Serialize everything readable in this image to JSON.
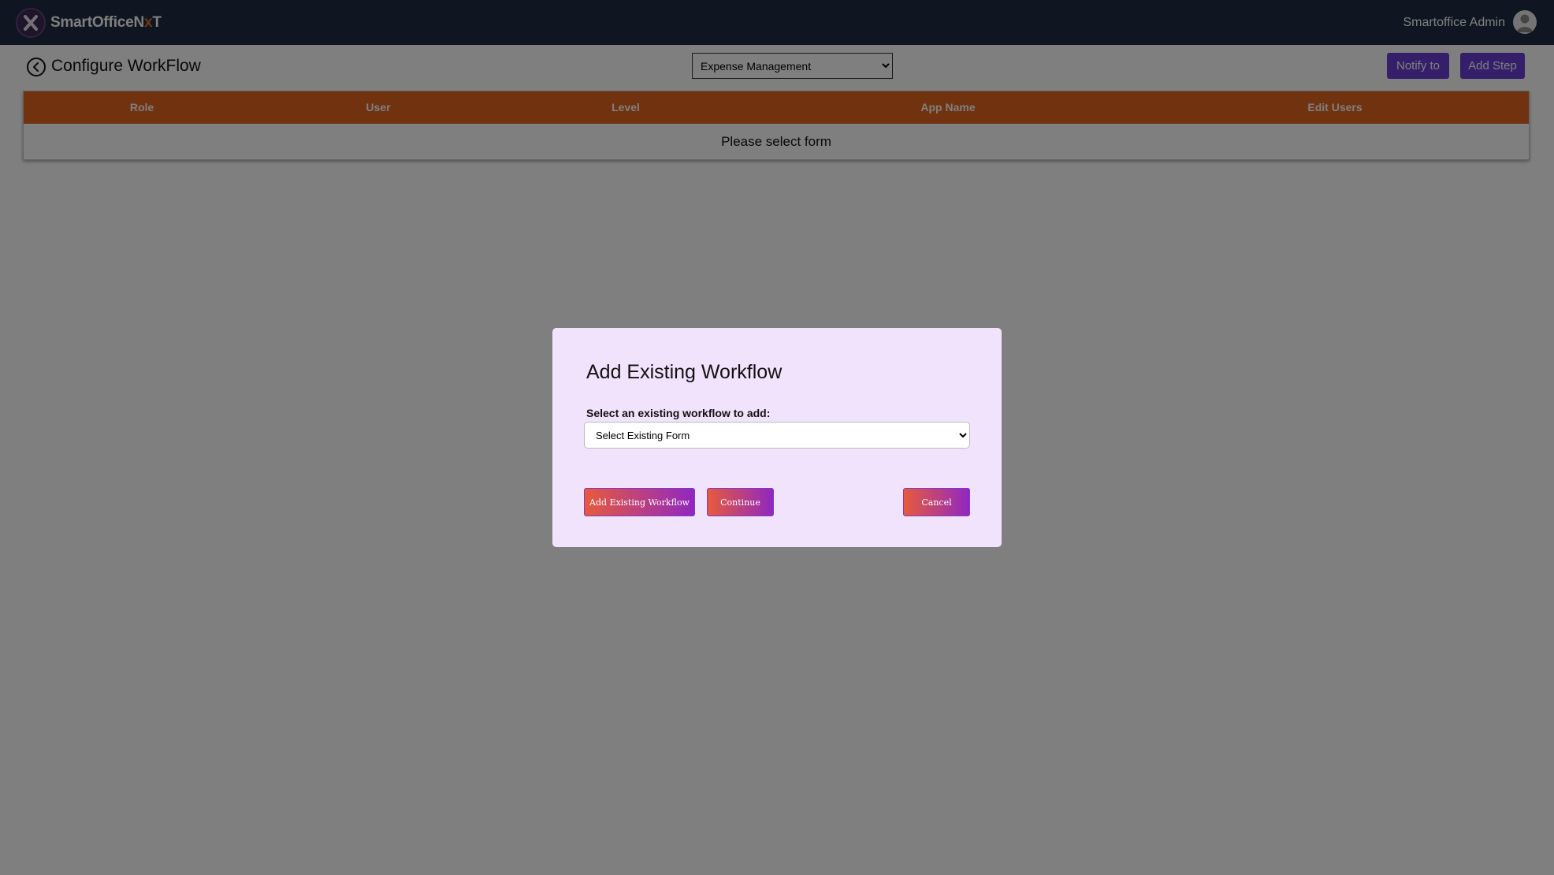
{
  "header": {
    "brand_prefix": "SmartOfficeN",
    "brand_ex": "x",
    "brand_suffix": "T",
    "user_name": "Smartoffice Admin"
  },
  "page": {
    "title": "Configure WorkFlow",
    "form_select_value": "Expense Management",
    "notify_label": "Notify to",
    "add_step_label": "Add Step"
  },
  "table": {
    "columns": [
      "Role",
      "User",
      "Level",
      "App Name",
      "Edit Users"
    ],
    "empty_message": "Please select form"
  },
  "modal": {
    "title": "Add Existing Workflow",
    "label": "Select an existing workflow to add:",
    "select_value": "Select Existing Form",
    "add_existing_label": "Add Existing Workflow",
    "continue_label": "Continue",
    "cancel_label": "Cancel"
  },
  "colors": {
    "topbar": "#1f2d45",
    "accent_purple": "#6b3fd6",
    "table_header": "#e0641e",
    "modal_bg": "#f2e3fc"
  }
}
